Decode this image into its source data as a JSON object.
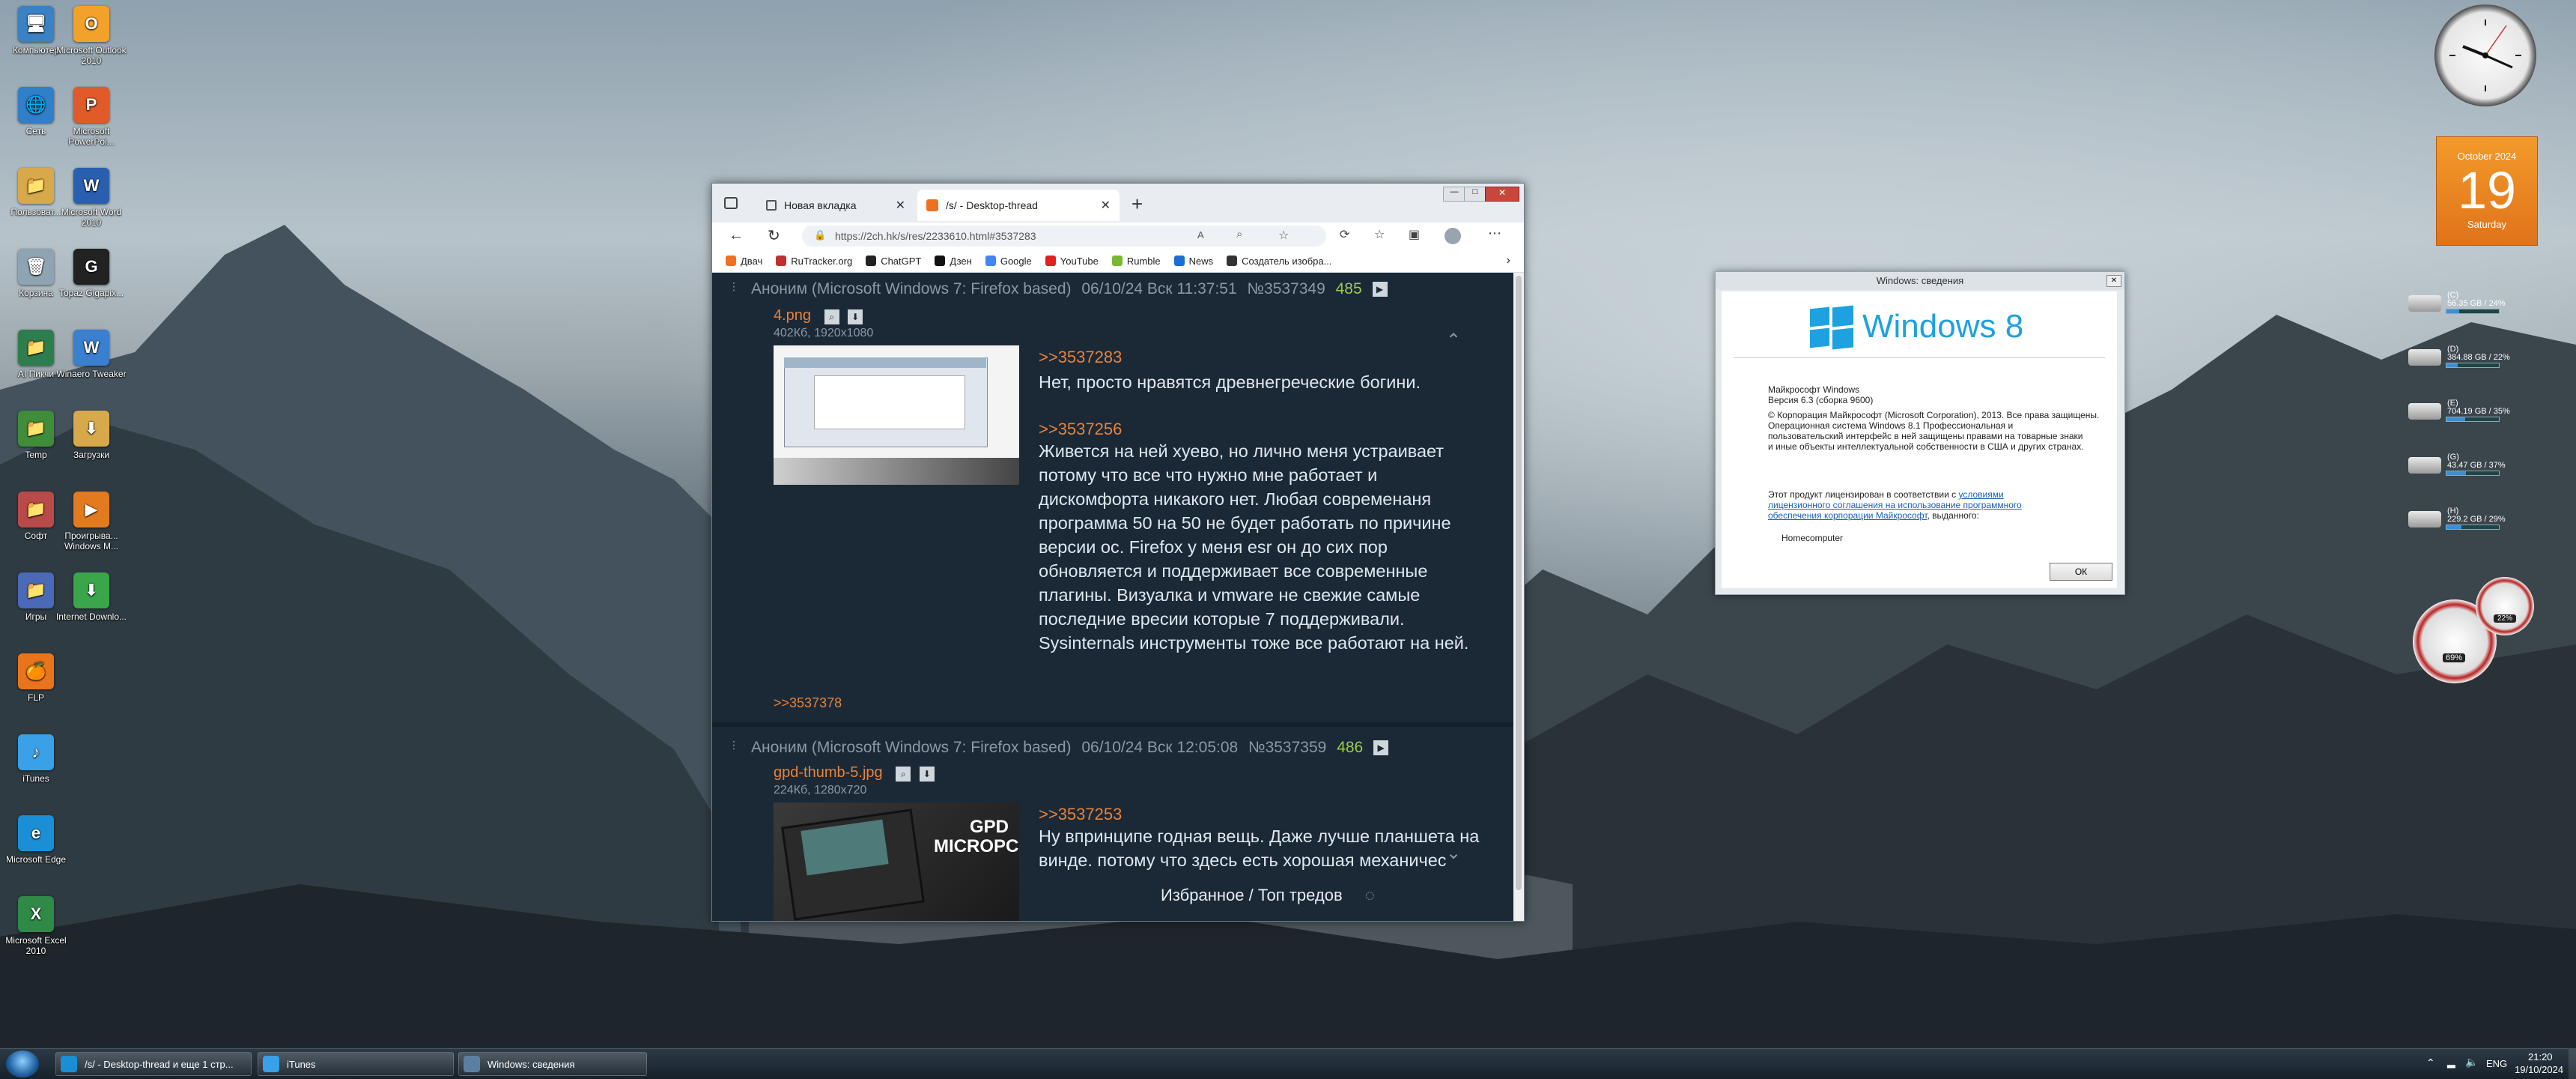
{
  "desktop": {
    "icons_col1": [
      {
        "label": "Компьютер",
        "color": "#3b82c4",
        "glyph": "🖥"
      },
      {
        "label": "Сеть",
        "color": "#2f7fc9",
        "glyph": "🌐"
      },
      {
        "label": "Пользоват...",
        "color": "#d8a94a",
        "glyph": "📁"
      },
      {
        "label": "Корзина",
        "color": "#8fa4b2",
        "glyph": "🗑"
      },
      {
        "label": "AI Пикчи",
        "color": "#2e7d4f",
        "glyph": "📁"
      },
      {
        "label": "Temp",
        "color": "#3f8c3a",
        "glyph": "📁"
      },
      {
        "label": "Софт",
        "color": "#b84a4a",
        "glyph": "📁"
      },
      {
        "label": "Игры",
        "color": "#4a6ab8",
        "glyph": "📁"
      },
      {
        "label": "FLP",
        "color": "#e8741c",
        "glyph": "🍊"
      },
      {
        "label": "iTunes",
        "color": "#3aa0e8",
        "glyph": "♪"
      },
      {
        "label": "Microsoft Edge",
        "color": "#1a8fd6",
        "glyph": "e"
      },
      {
        "label": "Microsoft Excel 2010",
        "color": "#2f8a48",
        "glyph": "X"
      }
    ],
    "icons_col2": [
      {
        "label": "Microsoft Outlook 2010",
        "color": "#f2a22a",
        "glyph": "O"
      },
      {
        "label": "Microsoft PowerPoi...",
        "color": "#e05a2a",
        "glyph": "P"
      },
      {
        "label": "Microsoft Word 2010",
        "color": "#2a5fb0",
        "glyph": "W"
      },
      {
        "label": "Topaz Gigapix...",
        "color": "#222222",
        "glyph": "G"
      },
      {
        "label": "Winaero Tweaker",
        "color": "#3a7fd0",
        "glyph": "W"
      },
      {
        "label": "Загрузки",
        "color": "#d8a94a",
        "glyph": "⬇"
      },
      {
        "label": "Проигрыва... Windows M...",
        "color": "#e27b1f",
        "glyph": "▶"
      },
      {
        "label": "Internet Downlo...",
        "color": "#3aa54a",
        "glyph": "⬇"
      }
    ]
  },
  "browser": {
    "tabs": [
      {
        "label": "Новая вкладка"
      },
      {
        "label": "/s/ - Desktop-thread"
      }
    ],
    "new_tab_glyph": "+",
    "address": "https://2ch.hk/s/res/2233610.html#3537283",
    "bookmarks": [
      {
        "label": "Двач",
        "color": "#f07020"
      },
      {
        "label": "RuTracker.org",
        "color": "#c03030"
      },
      {
        "label": "ChatGPT",
        "color": "#222222"
      },
      {
        "label": "Дзен",
        "color": "#111111"
      },
      {
        "label": "Google",
        "color": "#4285f4"
      },
      {
        "label": "YouTube",
        "color": "#e02020"
      },
      {
        "label": "Rumble",
        "color": "#78b832"
      },
      {
        "label": "News",
        "color": "#1a6fd0"
      },
      {
        "label": "Создатель изобра...",
        "color": "#333333"
      }
    ],
    "posts": [
      {
        "author": "Аноним (Microsoft Windows 7: Firefox based)",
        "date": "06/10/24 Вск 11:37:51",
        "id": "№3537349",
        "count": "485",
        "file": "4.png",
        "meta": "402Кб, 1920x1080",
        "replies": [
          {
            "ref": ">>3537283",
            "text": "Нет, просто нравятся древнегреческие богини."
          },
          {
            "ref": ">>3537256",
            "text": "Живется на ней хуево, но лично меня устраивает потому что все что нужно мне работает и дискомфорта никакого нет. Любая современаня программа 50 на 50 не будет работать по причине версии ос. Firefox у меня esr он до сих пор обновляется и поддерживает все современные плагины. Визуалка и vmware не свежие самые последние вресии которые 7 поддерживали. Sysinternals инструменты тоже все работают на ней."
          }
        ],
        "backlink": ">>3537378"
      },
      {
        "author": "Аноним (Microsoft Windows 7: Firefox based)",
        "date": "06/10/24 Вск 12:05:08",
        "id": "№3537359",
        "count": "486",
        "file": "gpd-thumb-5.jpg",
        "meta": "224Кб, 1280x720",
        "thumb_title": "GPD MICROPC",
        "replies": [
          {
            "ref": ">>3537253",
            "text": "Ну впринципе годная вещь. Даже лучше планшета на винде. потому что здесь есть хорошая механичес"
          }
        ]
      }
    ],
    "bottom_bar": "Избранное / Топ тредов"
  },
  "about": {
    "title": "Windows: сведения",
    "logo_text": "Windows 8",
    "lines": [
      "Майкрософт Windows",
      "Версия 6.3 (сборка 9600)",
      "© Корпорация Майкрософт (Microsoft Corporation), 2013. Все права защищены.",
      "Операционная система Windows 8.1 Профессиональная и",
      "пользовательский интерфейс в ней защищены правами на товарные знаки",
      "и иные объекты интеллектуальной собственности в США и других странах."
    ],
    "license_prefix": "Этот продукт лицензирован в соответствии с ",
    "license_link1": "условиями",
    "license_link2": "лицензионного соглашения на использование программного",
    "license_link3": "обеспечения корпорации Майкрософт",
    "license_suffix": ", выданного:",
    "owner": "Homecomputer",
    "ok_label": "ОК"
  },
  "gadgets": {
    "calendar_month": "October 2024",
    "calendar_day": "19",
    "calendar_weekday": "Saturday",
    "drives": [
      {
        "label": "(C)",
        "value": "56.35 GB / 24%",
        "fill": 0.24
      },
      {
        "label": "(D)",
        "value": "384.88 GB / 22%",
        "fill": 0.22
      },
      {
        "label": "(E)",
        "value": "704.19 GB / 35%",
        "fill": 0.35
      },
      {
        "label": "(G)",
        "value": "43.47 GB / 37%",
        "fill": 0.37
      },
      {
        "label": "(H)",
        "value": "229.2 GB / 29%",
        "fill": 0.29
      }
    ],
    "meter_cpu": "69%",
    "meter_ram": "22%"
  },
  "taskbar": {
    "buttons": [
      {
        "label": "/s/ - Desktop-thread и еще 1 стр...",
        "color": "#1a8fd6"
      },
      {
        "label": "iTunes",
        "color": "#3aa0e8"
      },
      {
        "label": "Windows: сведения",
        "color": "#5b7fa0"
      }
    ],
    "lang": "ENG",
    "time": "21:20",
    "date": "19/10/2024"
  }
}
